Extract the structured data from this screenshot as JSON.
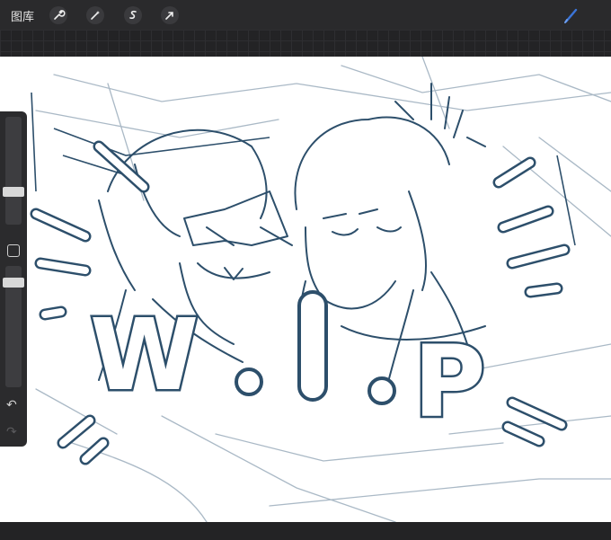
{
  "topbar": {
    "gallery_label": "图库",
    "tools": [
      "wrench-icon",
      "magic-wand-icon",
      "selection-icon",
      "transform-arrow-icon"
    ],
    "brush_icon": "brush-icon"
  },
  "sidebar": {
    "size_slider_level": 0.6,
    "opacity_slider_level": 0.9,
    "undo_icon": "undo-icon",
    "redo_icon": "redo-icon"
  },
  "canvas": {
    "wip_letters": [
      "W",
      ".",
      "I",
      ".",
      "P"
    ]
  },
  "colors": {
    "accent": "#3b74d8",
    "ink": "#2d4f6b",
    "sketch": "#aab9c6",
    "bar": "#2a2a2c"
  }
}
